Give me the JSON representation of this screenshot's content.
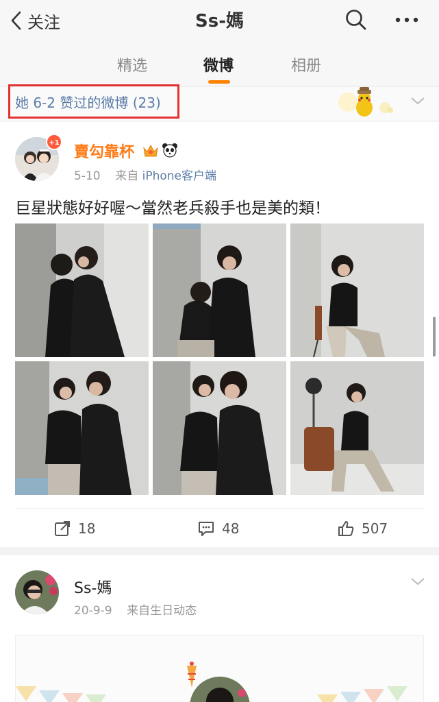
{
  "header": {
    "back_label": "关注",
    "title": "Ss-媽"
  },
  "tabs": [
    {
      "label": "精选"
    },
    {
      "label": "微博"
    },
    {
      "label": "相册"
    }
  ],
  "liked_strip": {
    "text": "她 6-2 赞过的微博 (23)"
  },
  "post": {
    "avatar_badge": "+1",
    "username": "賣勾靠杯",
    "date": "5-10",
    "source_prefix": "来自",
    "source": "iPhone客户端",
    "text": "巨星狀態好好喔～當然老兵殺手也是美的類！",
    "actions": {
      "repost_count": "18",
      "comment_count": "48",
      "like_count": "507"
    }
  },
  "post2": {
    "username": "Ss-媽",
    "date": "20-9-9",
    "source": "来自生日动态"
  },
  "colors": {
    "accent": "#ff8200",
    "link": "#5b7ca8",
    "highlight_box": "#e53030",
    "username": "#ff7c1a"
  },
  "icons": [
    "chevron-left-icon",
    "search-icon",
    "more-icon",
    "chevron-down-icon",
    "crown-icon",
    "panda-icon",
    "repost-icon",
    "comment-icon",
    "like-icon"
  ]
}
